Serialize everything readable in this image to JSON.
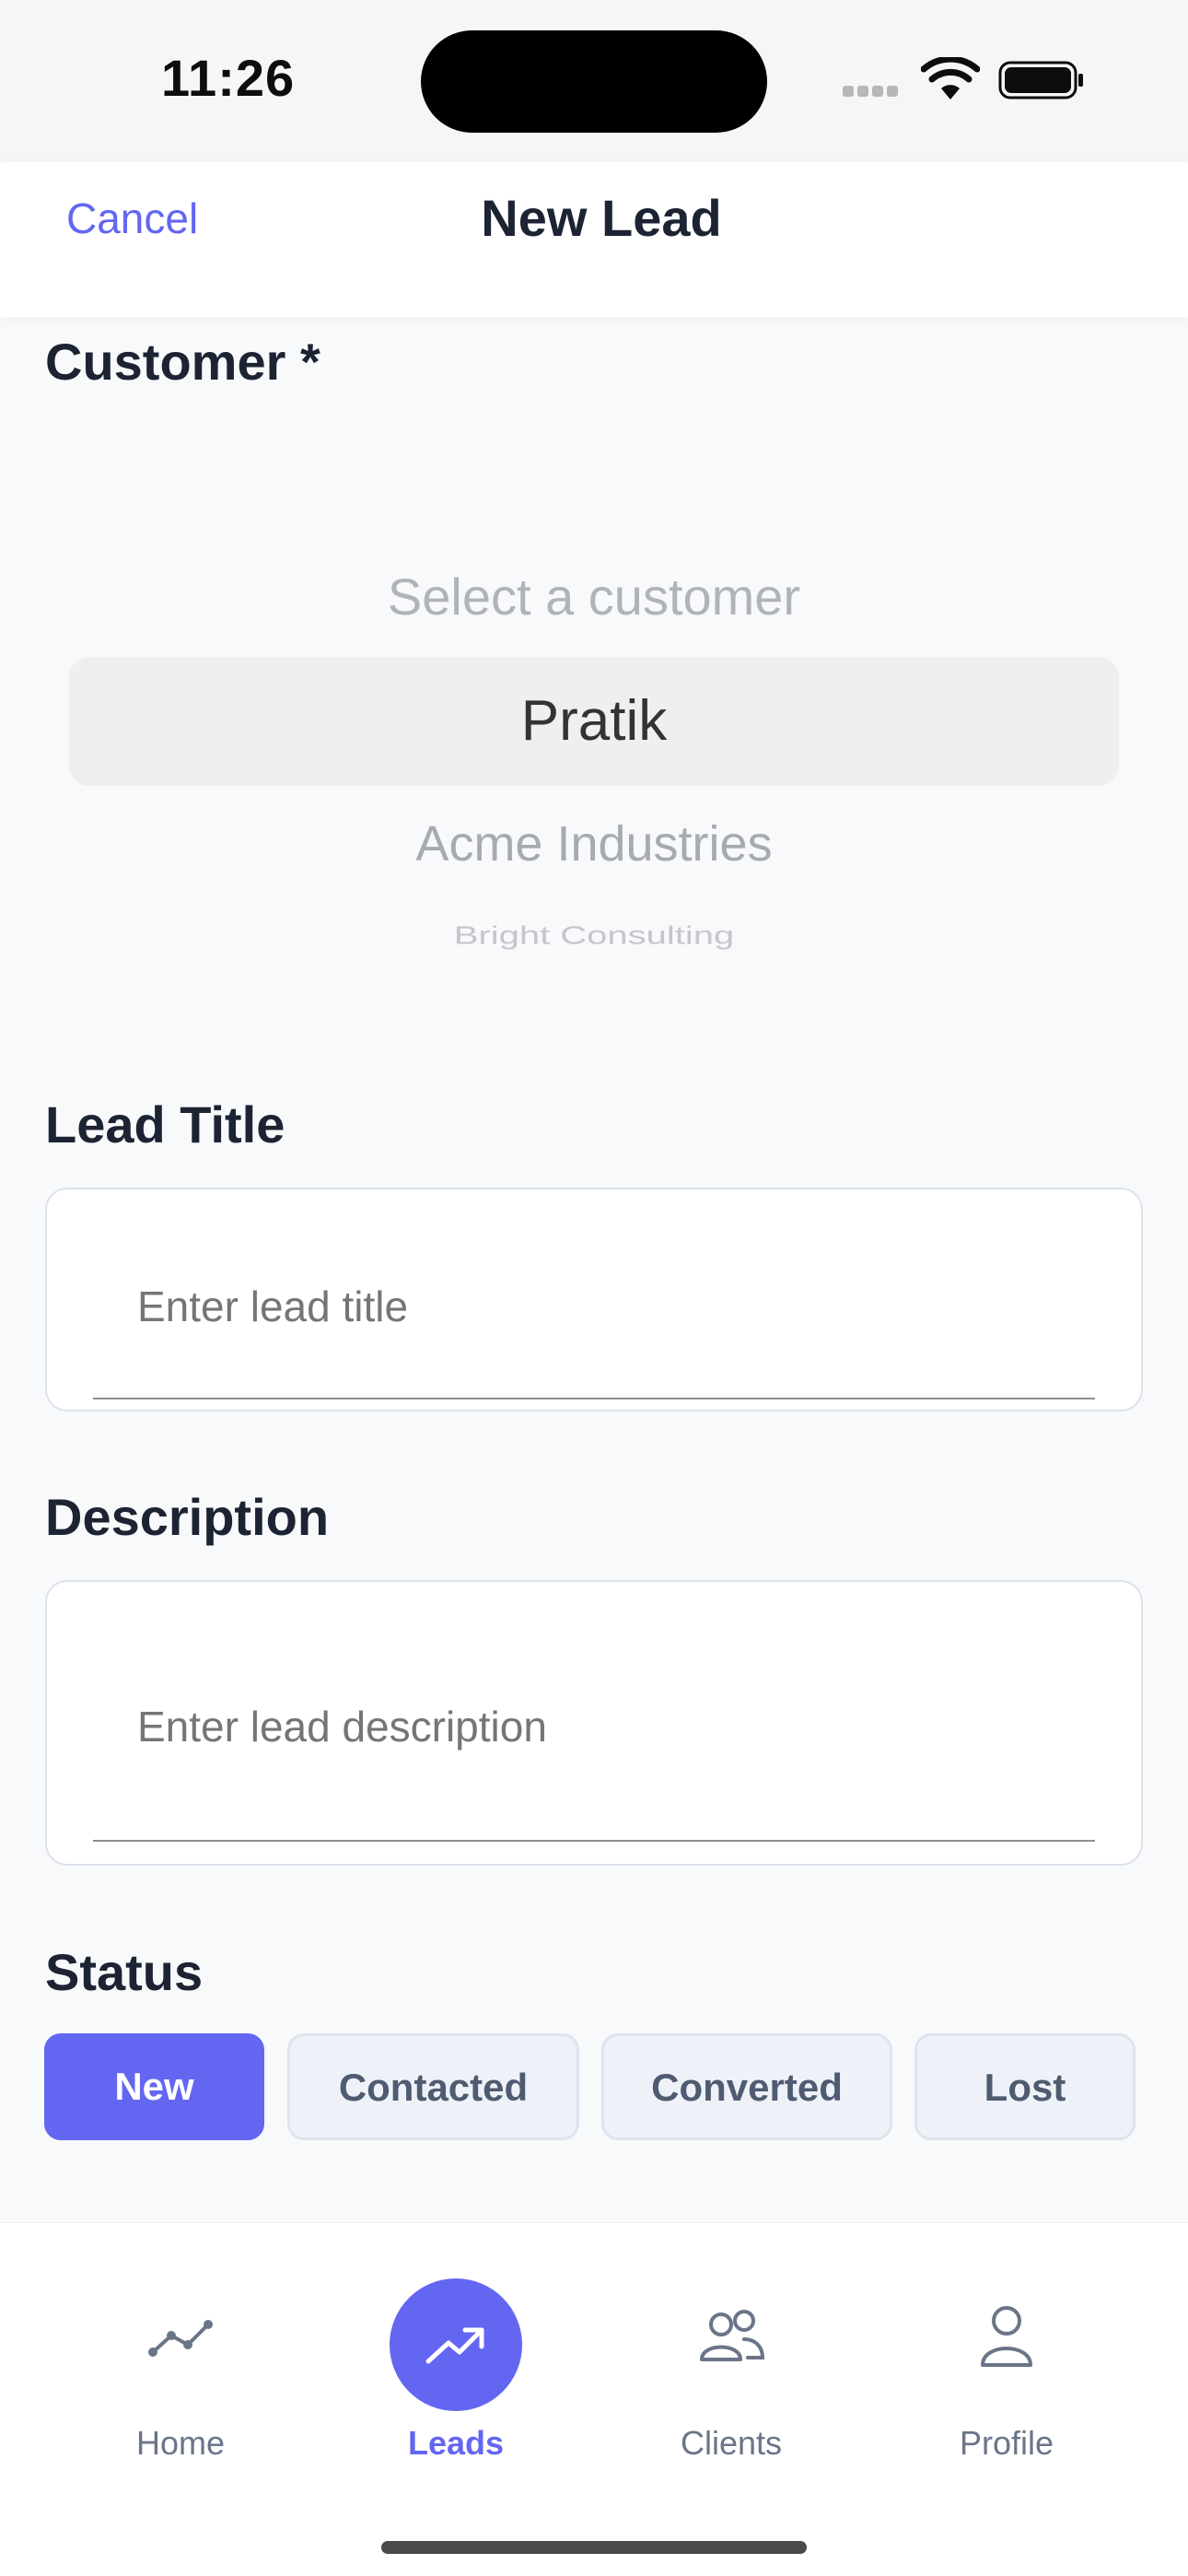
{
  "status_bar": {
    "time": "11:26"
  },
  "header": {
    "cancel_label": "Cancel",
    "title": "New Lead"
  },
  "customer": {
    "label": "Customer *",
    "picker_options": [
      "Select a customer",
      "Pratik",
      "Acme Industries",
      "Bright Consulting"
    ],
    "selected": "Pratik"
  },
  "lead_title": {
    "label": "Lead Title",
    "placeholder": "Enter lead title",
    "value": ""
  },
  "description": {
    "label": "Description",
    "placeholder": "Enter lead description",
    "value": ""
  },
  "status": {
    "label": "Status",
    "options": [
      "New",
      "Contacted",
      "Converted",
      "Lost"
    ],
    "selected": "New"
  },
  "tabs": [
    {
      "label": "Home",
      "icon": "chart-line-icon"
    },
    {
      "label": "Leads",
      "icon": "trending-up-icon",
      "active": true
    },
    {
      "label": "Clients",
      "icon": "users-icon"
    },
    {
      "label": "Profile",
      "icon": "user-icon"
    }
  ],
  "colors": {
    "accent": "#6366f1",
    "text": "#1c2433",
    "muted": "#6b7588"
  }
}
